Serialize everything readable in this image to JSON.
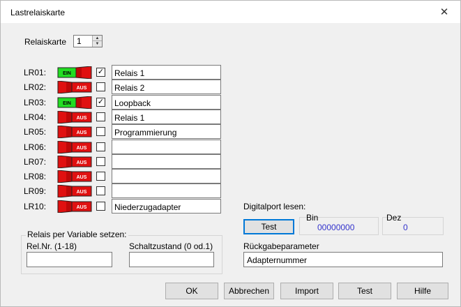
{
  "window": {
    "title": "Lastrelaiskarte"
  },
  "relaiskarte": {
    "label": "Relaiskarte",
    "value": "1"
  },
  "relays": [
    {
      "id": "LR01:",
      "state": "EIN",
      "on": true,
      "checked": true,
      "name": "Relais 1"
    },
    {
      "id": "LR02:",
      "state": "AUS",
      "on": false,
      "checked": false,
      "name": "Relais 2"
    },
    {
      "id": "LR03:",
      "state": "EIN",
      "on": true,
      "checked": true,
      "name": "Loopback"
    },
    {
      "id": "LR04:",
      "state": "AUS",
      "on": false,
      "checked": false,
      "name": "Relais 1"
    },
    {
      "id": "LR05:",
      "state": "AUS",
      "on": false,
      "checked": false,
      "name": "Programmierung"
    },
    {
      "id": "LR06:",
      "state": "AUS",
      "on": false,
      "checked": false,
      "name": ""
    },
    {
      "id": "LR07:",
      "state": "AUS",
      "on": false,
      "checked": false,
      "name": ""
    },
    {
      "id": "LR08:",
      "state": "AUS",
      "on": false,
      "checked": false,
      "name": ""
    },
    {
      "id": "LR09:",
      "state": "AUS",
      "on": false,
      "checked": false,
      "name": ""
    },
    {
      "id": "LR10:",
      "state": "AUS",
      "on": false,
      "checked": false,
      "name": "Niederzugadapter"
    }
  ],
  "relais_var": {
    "group_label": "Relais per Variable setzen:",
    "relnr_label": "Rel.Nr. (1-18)",
    "relnr_value": "",
    "schalt_label": "Schaltzustand (0 od.1)",
    "schalt_value": ""
  },
  "digitalport": {
    "label": "Digitalport lesen:",
    "test_button": "Test",
    "bin_label": "Bin",
    "bin_value": "00000000",
    "dez_label": "Dez",
    "dez_value": "0",
    "rueckgabe_label": "Rückgabeparameter",
    "rueckgabe_value": "Adapternummer"
  },
  "buttons": {
    "ok": "OK",
    "abbrechen": "Abbrechen",
    "import": "Import",
    "test": "Test",
    "hilfe": "Hilfe"
  },
  "colors": {
    "switch_on": "#22dd22",
    "switch_off": "#e01010",
    "value_blue": "#3333cc"
  }
}
